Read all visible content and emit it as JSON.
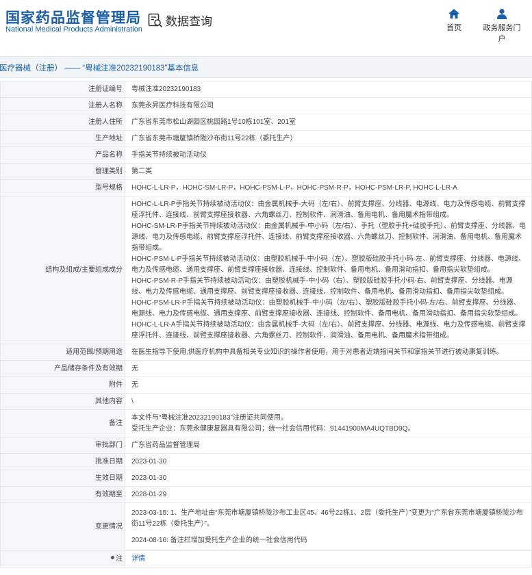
{
  "header": {
    "logo_cn": "国家药品监督管理局",
    "logo_en": "National Medical Products Administration",
    "query_label": "数据查询",
    "nav": [
      {
        "label": "首页",
        "icon": "home-icon"
      },
      {
        "label": "政务服务门户",
        "icon": "user-icon"
      }
    ]
  },
  "title": "医疗器械（注册） —— “粤械注准20232190183”基本信息",
  "details": [
    {
      "label": "注册证编号",
      "value": "粤械注准20232190183"
    },
    {
      "label": "注册人名称",
      "value": "东莞永昇医疗科技有限公司"
    },
    {
      "label": "注册人住所",
      "value": "广东省东莞市松山湖园区桃园路1号10栋101室、201室"
    },
    {
      "label": "生产地址",
      "value": "广东省东莞市塘厦镇桥陇沙布街11号22栋（委托生产）"
    },
    {
      "label": "产品名称",
      "value": "手指关节持续被动活动仪"
    },
    {
      "label": "管理类别",
      "value": "第二类"
    },
    {
      "label": "型号规格",
      "value": "HOHC-L-LR-P，HOHC-SM-LR-P，HOHC-PSM-L-P，HOHC-PSM-R-P，HOHC-PSM-LR-P, HOHC-L-LR-A"
    },
    {
      "label": "结构及组成/主要组成成分",
      "lines": [
        "HOHC-L-LR-P手指关节持续被动活动仪：由金属机械手-大码（左/右）、前臂支撑座、分线器、电源线、电力及传感电缆、前臂支撑座浮托件、连接线、前臂支撑座接收器、六角螺丝刀、控制软件、润滑油、备用电机、备用魔术指带组成。",
        "HOHC-SM-LR-P手指关节持续被动活动仪：由金属机械手-中小码（左/右）、手托（塑胶手托+硅胶手托）、前臂支撑座、分线器、电源线、电力及传感电缆、前臂支撑座浮托件、连接线、前臂支撑座接收器、六角螺丝刀、控制软件、润滑油、备用电机、备用魔术指带组成。",
        "HOHC-PSM-L-P手指关节持续被动活动仪：由塑胶机械手-中小码（左）、塑胶版硅胶手托小码-左、前臂支撑座、分线器、电源线、电力及传感电缆、通用支撑座、前臂支撑座接收器、连接线、控制软件、备用电机、备用滑动指扣、备用指尖软垫组成。",
        "HOHC-PSM-R-P手指关节持续被动活动仪：由塑胶机械手-中小码（右）、塑胶版硅胶手托小码-右、前臂支撑座、分线器、电源线、电力及传感电缆、通用支撑座、前臂支撑座接收器、连接线、控制软件、备用电机、备用滑动指扣、备用指尖软垫组成。",
        "HOHC-PSM-LR-P手指关节持续被动活动仪：由塑胶机械手-中小码（左/右）、塑胶版硅胶手托小码-左/右、前臂支撑座、分线器、电源线、电力及传感电缆、通用支撑座、前臂支撑座接收器、连接线、控制软件、备用电机、备用滑动指扣、备用指尖软垫组成。",
        "HOHC-L-LR-A手指关节持续被动活动仪：由金属机械手-大码（左/右）、前臂支撑座、分线器、电源线、电力及传感电缆、前臂支撑座浮托件、连接线、前臂支撑座接收器、六角螺丝刀、控制软件、润滑油、备用电机、备用魔术指带组成。"
      ]
    },
    {
      "label": "适用范围/预期用途",
      "value": "在医生指导下使用,供医疗机构中具备相关专业知识的操作者使用，用于对患者近端指间关节和掌指关节进行被动康复训练。"
    },
    {
      "label": "产品储存条件及有效期",
      "value": "无"
    },
    {
      "label": "附件",
      "value": "无"
    },
    {
      "label": "其他内容",
      "value": "\\"
    },
    {
      "label": "备注",
      "lines": [
        "本文件与“粤械注准20232190183”注册证共同使用。",
        "受托生产企业：东莞永健康复器具有限公司；统一社会信用代码：91441900MA4UQTBD9Q。"
      ]
    },
    {
      "label": "审批部门",
      "value": "广东省药品监督管理局"
    },
    {
      "label": "批准日期",
      "value": "2023-01-30"
    },
    {
      "label": "生效日期",
      "value": "2023-01-30"
    },
    {
      "label": "有效期至",
      "value": "2028-01-29"
    },
    {
      "label": "变更情况",
      "lines": [
        "2023-03-15: 1、生产地址由“东莞市塘厦镇桥陇沙布工业区45、46号22栋1、2层（委托生产）”变更为“广东省东莞市塘厦镇桥陇沙布街11号22栋（委托生产）”。",
        "2024-08-16: 备注栏增加受托生产企业的统一社会信用代码"
      ]
    },
    {
      "label": "注",
      "link": "详情"
    }
  ]
}
